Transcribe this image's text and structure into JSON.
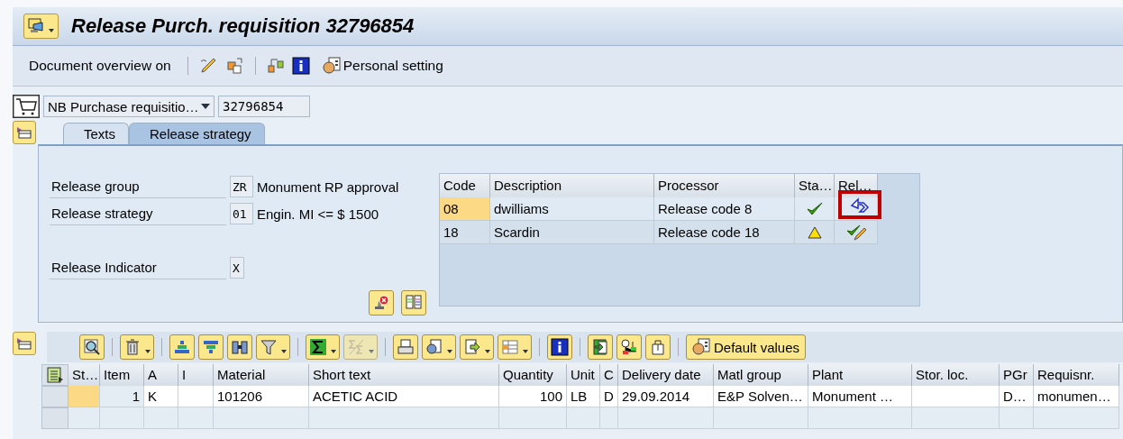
{
  "window": {
    "title": "Release Purch. requisition 32796854"
  },
  "toolbar": {
    "overview_button": "Document overview on",
    "personal_button": "Personal setting"
  },
  "header": {
    "doc_type": "NB Purchase requisitio…",
    "doc_number": "32796854"
  },
  "tabs": [
    {
      "label": "Texts",
      "selected": false
    },
    {
      "label": "Release strategy",
      "selected": true
    }
  ],
  "release_fields": [
    {
      "label": "Release group",
      "value": "ZR",
      "description": "Monument RP approval"
    },
    {
      "label": "Release strategy",
      "value": "01",
      "description": "Engin. MI <= $ 1500"
    },
    {
      "label": "Release Indicator",
      "value": "X"
    }
  ],
  "release_table": {
    "columns": [
      "Code",
      "Description",
      "Processor",
      "Sta…",
      "Rel…"
    ],
    "rows": [
      {
        "code": "08",
        "description": "dwilliams",
        "processor": "Release code 8",
        "selected": true,
        "released": true,
        "highlighted": true
      },
      {
        "code": "18",
        "description": "Scardin",
        "processor": "Release code 18",
        "selected": false,
        "released": false,
        "highlighted": false
      }
    ]
  },
  "items_toolbar": {
    "default_button": "Default values"
  },
  "items_table": {
    "columns": [
      "St…",
      "Item",
      "A",
      "I",
      "Material",
      "Short text",
      "Quantity",
      "Unit",
      "C",
      "Delivery date",
      "Matl group",
      "Plant",
      "Stor. loc.",
      "PGr",
      "Requisnr."
    ],
    "rows": [
      [
        "",
        "1",
        "K",
        "",
        "101206",
        "ACETIC ACID",
        "100",
        "LB",
        "D",
        "29.09.2014",
        "E&P Solven…",
        "Monument …",
        "",
        "D…",
        "monumen…"
      ]
    ]
  }
}
